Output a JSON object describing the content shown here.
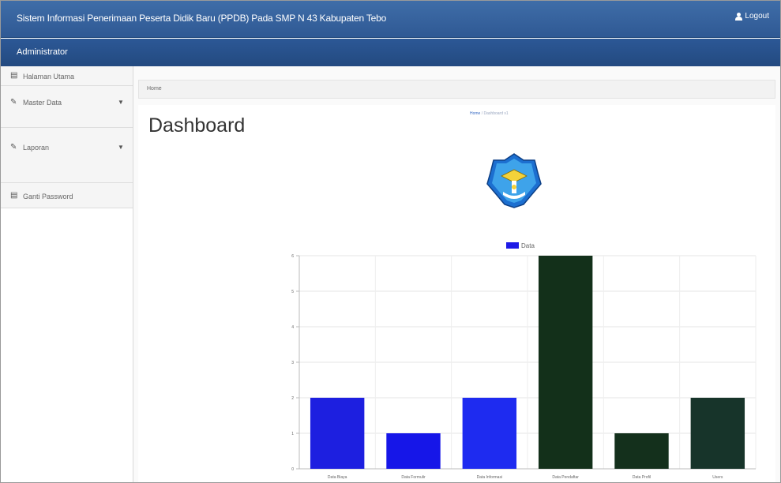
{
  "header": {
    "app_title": "Sistem Informasi Penerimaan Peserta Didik Baru (PPDB) Pada SMP N 43 Kabupaten Tebo",
    "logout_label": "Logout",
    "role": "Administrator"
  },
  "sidebar": {
    "items": [
      {
        "label": "Halaman Utama",
        "icon": "table-icon",
        "has_dropdown": false
      },
      {
        "label": "Master Data",
        "icon": "edit-icon",
        "has_dropdown": true
      },
      {
        "label": "Laporan",
        "icon": "edit-icon",
        "has_dropdown": true
      },
      {
        "label": "Ganti Password",
        "icon": "table-icon",
        "has_dropdown": false
      }
    ]
  },
  "breadcrumb": {
    "home": "Home"
  },
  "main": {
    "title": "Dashboard",
    "inner_breadcrumb": {
      "home": "Home",
      "separator": "/",
      "current": "Dashboard v1"
    }
  },
  "colors": {
    "header": "#2f5994",
    "bar_blue": "#1d22e0",
    "bar_dark_green": "#15301c",
    "bar_green": "#183424",
    "legend": "#1d1ae6"
  },
  "chart_data": {
    "type": "bar",
    "categories": [
      "Data Biaya",
      "Data Formulir",
      "Data Informasi",
      "Data Pendaftar",
      "Data Profil",
      "Users"
    ],
    "series": [
      {
        "name": "Data",
        "values": [
          2,
          1,
          2,
          6,
          1,
          2
        ]
      }
    ],
    "colors": [
      "#1d1fe0",
      "#1616e8",
      "#1e2bf0",
      "#13301a",
      "#14301c",
      "#17342a"
    ],
    "ylim": [
      0,
      6
    ],
    "yticks": [
      "0",
      "1",
      "2",
      "3",
      "4",
      "5",
      "6"
    ],
    "legend_position": "top",
    "grid": true
  }
}
